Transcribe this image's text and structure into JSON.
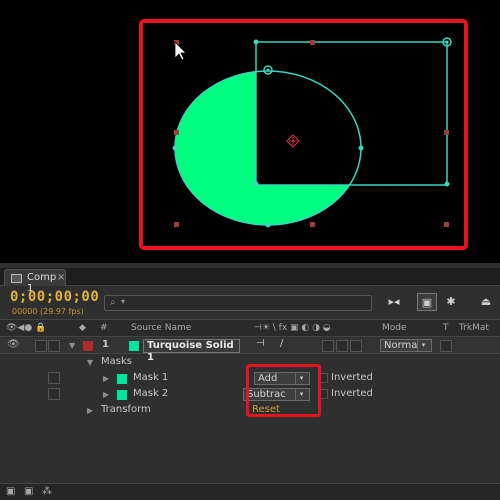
{
  "comp_tab": {
    "label": "Comp 1",
    "close": "×"
  },
  "timecode": {
    "value": "0;00;00;00",
    "fps": "00000 (29.97 fps)"
  },
  "search": {
    "icon": "search-icon",
    "chevron": "▾"
  },
  "toolbar": {
    "icons": [
      "flow-icon",
      "draft-3d-icon",
      "shy-icon",
      "motion-blur-icon"
    ]
  },
  "columns": {
    "hash": "#",
    "source_name": "Source Name",
    "switches": "⊣☀ \\ fx ▣ ◐ ◑ ◒",
    "mode": "Mode",
    "t": "T",
    "trkmat": "TrkMat"
  },
  "layer": {
    "number": "1",
    "name": "Turquoise Solid 1",
    "color": "#00e5a0",
    "label_color": "#b02a2a",
    "mode": "Norma",
    "mode_arrow": "▾"
  },
  "masks": {
    "group_label": "Masks",
    "items": [
      {
        "name": "Mask 1",
        "color": "#00e5a0",
        "mode": "Add",
        "inverted_label": "Inverted"
      },
      {
        "name": "Mask 2",
        "color": "#00e5a0",
        "mode": "Subtrac",
        "inverted_label": "Inverted"
      }
    ]
  },
  "transform": {
    "label": "Transform",
    "reset": "Reset"
  },
  "colors": {
    "solid": "#00ff80",
    "mask_path": "#3ad6c0",
    "highlight": "#e5141e",
    "timecode": "#e3b23a"
  }
}
